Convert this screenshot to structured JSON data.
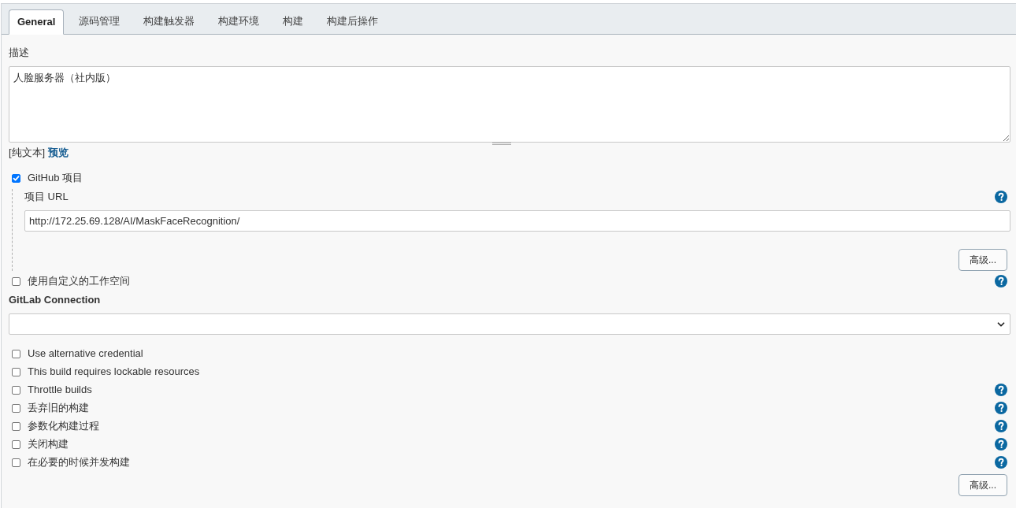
{
  "tabs": [
    {
      "label": "General",
      "selected": true
    },
    {
      "label": "源码管理",
      "selected": false
    },
    {
      "label": "构建触发器",
      "selected": false
    },
    {
      "label": "构建环境",
      "selected": false
    },
    {
      "label": "构建",
      "selected": false
    },
    {
      "label": "构建后操作",
      "selected": false
    }
  ],
  "description": {
    "label": "描述",
    "value": "人脸服务器（社内版）",
    "format": "[纯文本]",
    "preview_link": "预览"
  },
  "github_project": {
    "label": "GitHub 项目",
    "checked": true,
    "url_label": "项目 URL",
    "url_help": true,
    "url_value": "http://172.25.69.128/AI/MaskFaceRecognition/",
    "advanced_button": "高级..."
  },
  "custom_workspace": {
    "label": "使用自定义的工作空间",
    "checked": false,
    "help": true
  },
  "gitlab_connection": {
    "label": "GitLab Connection"
  },
  "options": [
    {
      "label": "Use alternative credential",
      "checked": false,
      "help": false
    },
    {
      "label": "This build requires lockable resources",
      "checked": false,
      "help": false
    },
    {
      "label": "Throttle builds",
      "checked": false,
      "help": true
    },
    {
      "label": "丢弃旧的构建",
      "checked": false,
      "help": true
    },
    {
      "label": "参数化构建过程",
      "checked": false,
      "help": true
    },
    {
      "label": "关闭构建",
      "checked": false,
      "help": true
    },
    {
      "label": "在必要的时候并发构建",
      "checked": false,
      "help": true
    }
  ],
  "advanced_button": "高级..."
}
